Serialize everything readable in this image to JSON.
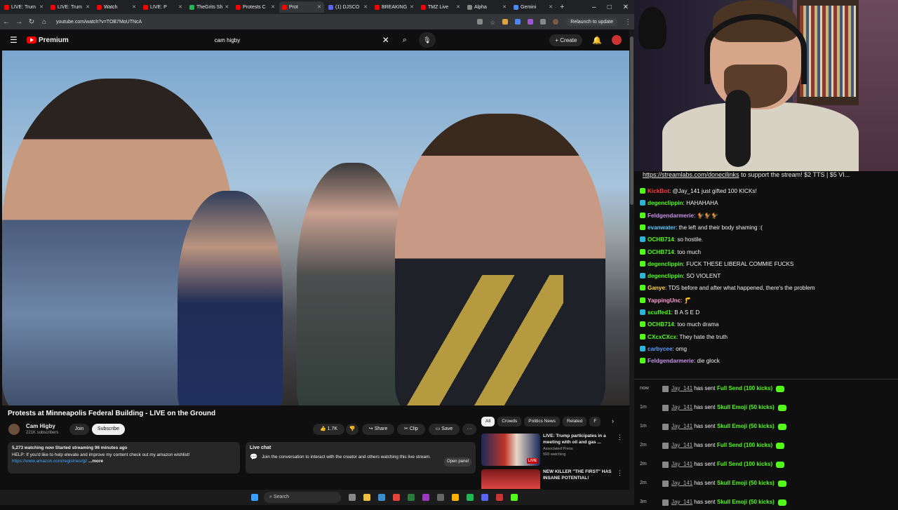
{
  "browser": {
    "tabs": [
      {
        "label": "LIVE: Trum",
        "active": false
      },
      {
        "label": "LIVE: Trum",
        "active": false
      },
      {
        "label": "Watch",
        "active": false
      },
      {
        "label": "LIVE: P",
        "active": false
      },
      {
        "label": "TheGrits Sh",
        "active": false
      },
      {
        "label": "Protests C",
        "active": false
      },
      {
        "label": "Prot",
        "active": true
      },
      {
        "label": "(1) DJSCO",
        "active": false
      },
      {
        "label": "BREAKING",
        "active": false
      },
      {
        "label": "TMZ Live",
        "active": false
      },
      {
        "label": "Alpha",
        "active": false
      },
      {
        "label": "Gemini",
        "active": false
      }
    ],
    "url": "youtube.com/watch?v=TOB7MoUTNcA",
    "relaunch_label": "Relaunch to update"
  },
  "youtube": {
    "logo_text": "Premium",
    "search_value": "cam higby",
    "create_label": "Create",
    "video_title": "Protests at Minneapolis Federal Building - LIVE on the Ground",
    "channel_name": "Cam Higby",
    "channel_subs": "221K subscribers",
    "join_label": "Join",
    "subscribe_label": "Subscribe",
    "likes": "1.7K",
    "share_label": "Share",
    "clip_label": "Clip",
    "save_label": "Save",
    "description": {
      "stats": "5,273 watching now  Started streaming 96 minutes ago",
      "text": "HELP: If you'd like to help elevate and improve my content check out my amazon wishlist!",
      "link": "https://www.amazon.com/registries/gl/",
      "more": "...more"
    },
    "live_chat": {
      "title": "Live chat",
      "text": "Join the conversation to interact with the creator and others watching this live stream.",
      "open_panel": "Open panel"
    },
    "chips": [
      {
        "label": "All",
        "selected": true
      },
      {
        "label": "Crowds",
        "selected": false
      },
      {
        "label": "Politics News",
        "selected": false
      },
      {
        "label": "Related",
        "selected": false
      },
      {
        "label": "F",
        "selected": false
      }
    ],
    "recommendations": [
      {
        "title": "LIVE: Trump participates in a meeting with oil and gas ...",
        "channel": "Associated Press",
        "meta": "593 watching",
        "badge": "LIVE"
      },
      {
        "title": "NEW KILLER \"THE FIRST\" HAS INSANE POTENTIAL!",
        "channel": "",
        "meta": ""
      }
    ]
  },
  "taskbar": {
    "search_placeholder": "Search"
  },
  "stream": {
    "tip_banner_link": "https://streamlabs.com/donecilinks",
    "tip_banner_rest": " to support the stream! $2 TTS | $5 VI..."
  },
  "chat": [
    {
      "user": "KickBot",
      "text": "@Jay_141 just gifted 100 KICKs!",
      "color": "#ff3b3b"
    },
    {
      "user": "degenclippin",
      "text": "HAHAHAHA",
      "color": "#53fc18"
    },
    {
      "user": "Feldgendarmerie",
      "text": "🐓🐓🐓",
      "color": "#c792ea"
    },
    {
      "user": "evanwater",
      "text": "the left and their body shaming :(",
      "color": "#5cc8ff"
    },
    {
      "user": "OCHB714",
      "text": "so hostile.",
      "color": "#53fc18"
    },
    {
      "user": "OCHB714",
      "text": "too much",
      "color": "#53fc18"
    },
    {
      "user": "degenclippin",
      "text": "FUCK THESE LIBERAL COMMIE FUCKS",
      "color": "#53fc18"
    },
    {
      "user": "degenclippin",
      "text": "SO VIOLENT",
      "color": "#53fc18"
    },
    {
      "user": "Ganye",
      "text": "TDS before and after what happened, there's the problem",
      "color": "#ffd54f"
    },
    {
      "user": "YappingUnc",
      "text": "🦵",
      "color": "#ff9ad5"
    },
    {
      "user": "scuffed1",
      "text": "B A S E D",
      "color": "#53fc18"
    },
    {
      "user": "OCHB714",
      "text": "too much drama",
      "color": "#53fc18"
    },
    {
      "user": "CXcxCXcx",
      "text": "They hate the truth",
      "color": "#53fc18"
    },
    {
      "user": "carbycee",
      "text": "omg",
      "color": "#5c9dff"
    },
    {
      "user": "Feldgendarmerie",
      "text": "die glock",
      "color": "#c792ea"
    }
  ],
  "events": [
    {
      "time": "now",
      "user": "Jay_141",
      "action": " has sent ",
      "gift": "Full Send (100 kicks)"
    },
    {
      "time": "1m",
      "user": "Jay_141",
      "action": " has sent ",
      "gift": "Skull Emoji (50 kicks)"
    },
    {
      "time": "1m",
      "user": "Jay_141",
      "action": " has sent ",
      "gift": "Skull Emoji (50 kicks)"
    },
    {
      "time": "2m",
      "user": "Jay_141",
      "action": " has sent ",
      "gift": "Full Send (100 kicks)"
    },
    {
      "time": "2m",
      "user": "Jay_141",
      "action": " has sent ",
      "gift": "Full Send (100 kicks)"
    },
    {
      "time": "2m",
      "user": "Jay_141",
      "action": " has sent ",
      "gift": "Skull Emoji (50 kicks)"
    },
    {
      "time": "3m",
      "user": "Jay_141",
      "action": " has sent ",
      "gift": "Skull Emoji (50 kicks)"
    }
  ]
}
